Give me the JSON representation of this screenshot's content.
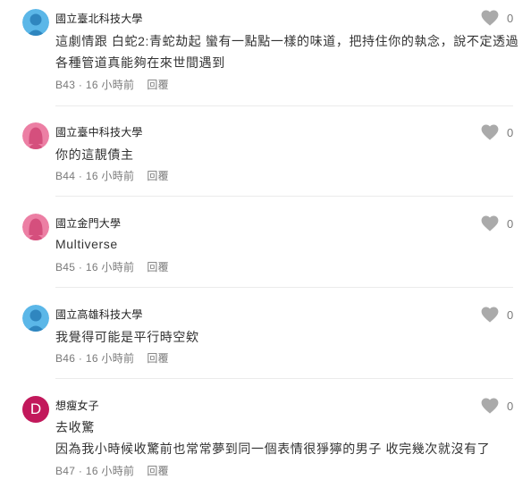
{
  "comments": [
    {
      "author": "國立臺北科技大學",
      "avatar": {
        "type": "person-icon",
        "color": "#5bb7e8"
      },
      "lines": [
        "這劇情跟 白蛇2:青蛇劫起 蠻有一點點一樣的味道，把持住你的執念，說不定透過",
        "各種管道真能夠在來世間遇到"
      ],
      "floor": "B43",
      "time": "16 小時前",
      "reply": "回覆",
      "likes": "0"
    },
    {
      "author": "國立臺中科技大學",
      "avatar": {
        "type": "person-icon",
        "color": "#ec7fa4"
      },
      "lines": [
        "你的這靚債主"
      ],
      "floor": "B44",
      "time": "16 小時前",
      "reply": "回覆",
      "likes": "0"
    },
    {
      "author": "國立金門大學",
      "avatar": {
        "type": "person-icon",
        "color": "#ec7fa4"
      },
      "lines": [
        "Multiverse"
      ],
      "floor": "B45",
      "time": "16 小時前",
      "reply": "回覆",
      "likes": "0"
    },
    {
      "author": "國立高雄科技大學",
      "avatar": {
        "type": "person-icon",
        "color": "#5bb7e8"
      },
      "lines": [
        "我覺得可能是平行時空欸"
      ],
      "floor": "B46",
      "time": "16 小時前",
      "reply": "回覆",
      "likes": "0"
    },
    {
      "author": "想瘦女子",
      "avatar": {
        "type": "letter",
        "letter": "D",
        "color": "#c2185b"
      },
      "lines": [
        "去收驚",
        "因為我小時候收驚前也常常夢到同一個表情很猙獰的男子 收完幾次就沒有了"
      ],
      "floor": "B47",
      "time": "16 小時前",
      "reply": "回覆",
      "likes": "0"
    }
  ]
}
